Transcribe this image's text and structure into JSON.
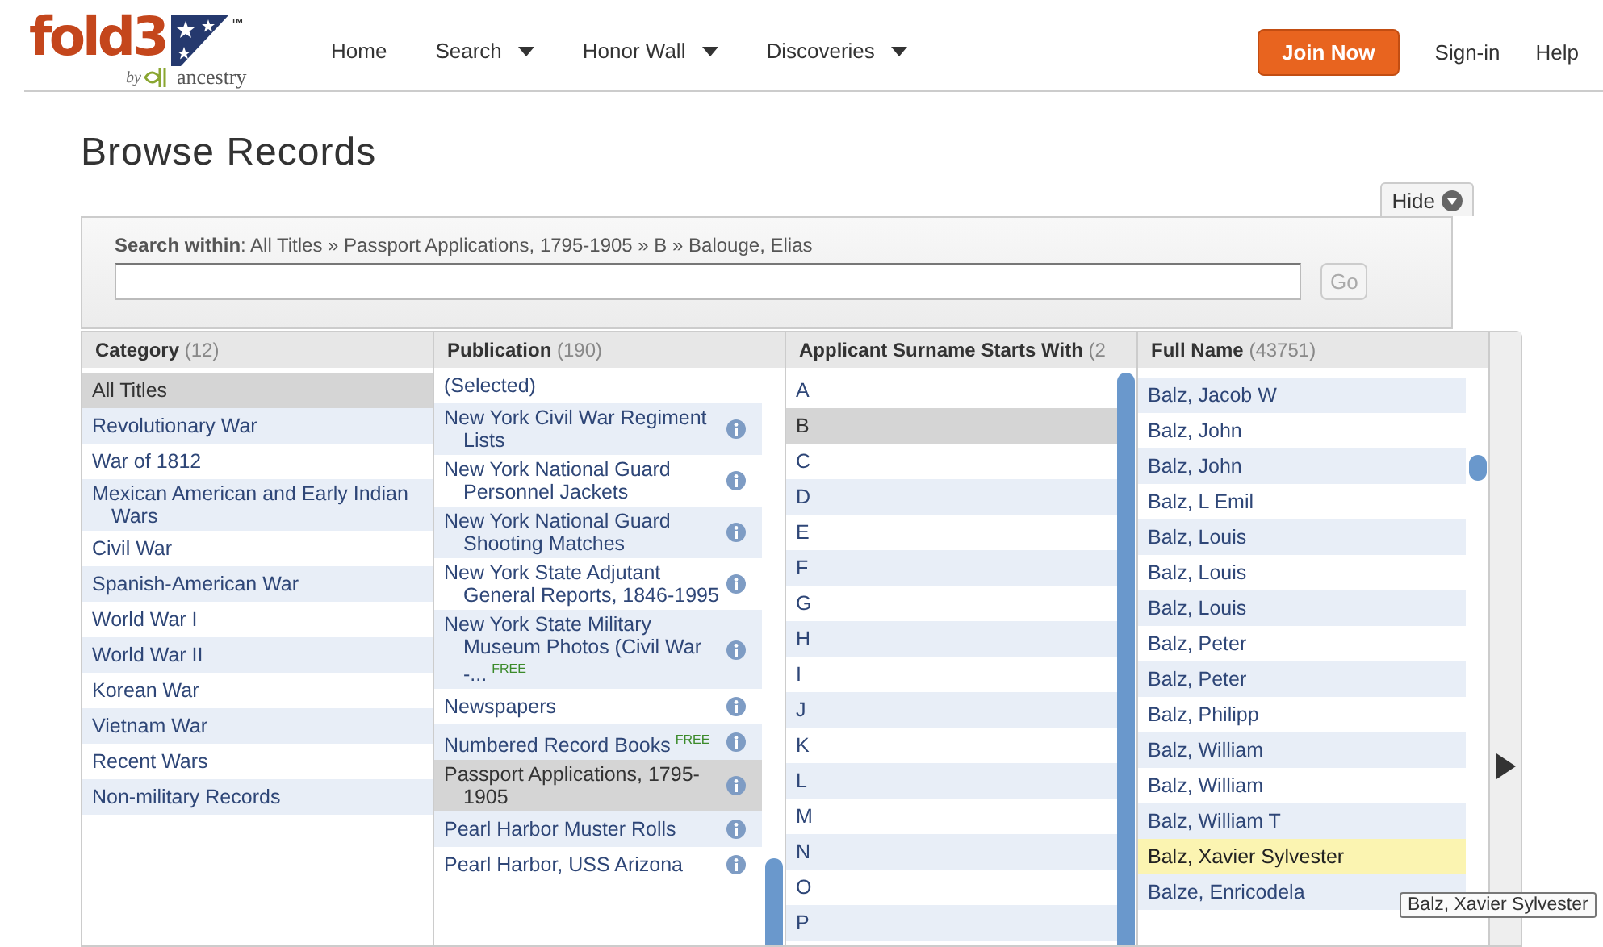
{
  "header": {
    "logo": {
      "name": "fold3",
      "trademark": "™",
      "by": "by",
      "partner": "ancestry"
    },
    "nav": [
      {
        "label": "Home",
        "dropdown": false
      },
      {
        "label": "Search",
        "dropdown": true
      },
      {
        "label": "Honor Wall",
        "dropdown": true
      },
      {
        "label": "Discoveries",
        "dropdown": true
      }
    ],
    "join_button": "Join Now",
    "links": [
      "Sign-in",
      "Help"
    ]
  },
  "title": "Browse Records",
  "hide_button": {
    "label": "Hide"
  },
  "search": {
    "label": "**Search within**: All Titles » Passport Applications, 1795-1905 » B » Balouge, Elias",
    "go_button": {
      "label": "Go",
      "disabled": true
    }
  },
  "columns": [
    {
      "title": "Category",
      "count": "(12)",
      "items": [
        {
          "label": "All Titles",
          "selected": true
        },
        {
          "label": "Revolutionary War",
          "selected": false
        },
        {
          "label": "War of 1812",
          "selected": false
        },
        {
          "label": "Mexican American and Early Indian Wars",
          "selected": false
        },
        {
          "label": "Civil War",
          "selected": false
        },
        {
          "label": "Spanish-American War",
          "selected": false
        },
        {
          "label": "World War I",
          "selected": false
        },
        {
          "label": "World War II",
          "selected": false
        },
        {
          "label": "Korean War",
          "selected": false
        },
        {
          "label": "Vietnam War",
          "selected": false
        },
        {
          "label": "Recent Wars",
          "selected": false
        },
        {
          "label": "Non-military Records",
          "selected": false
        }
      ]
    },
    {
      "title": "Publication",
      "count": "(190)",
      "items": [
        {
          "label": "(Selected)",
          "selected": false,
          "info": false
        },
        {
          "label": "New York Civil War Regiment Lists",
          "selected": false,
          "info": true
        },
        {
          "label": "New York National Guard Personnel Jackets",
          "selected": false,
          "info": true
        },
        {
          "label": "New York National Guard Shooting Matches",
          "selected": false,
          "info": true
        },
        {
          "label": "New York State Adjutant General Reports, 1846-1995",
          "selected": false,
          "info": true
        },
        {
          "label": "New York State Military Museum Photos (Civil War -...",
          "selected": false,
          "info": true,
          "badge": "FREE"
        },
        {
          "label": "Newspapers",
          "selected": false,
          "info": true
        },
        {
          "label": "Numbered Record Books",
          "selected": false,
          "info": true,
          "badge": "FREE"
        },
        {
          "label": "Passport Applications, 1795-1905",
          "selected": true,
          "info": true
        },
        {
          "label": "Pearl Harbor Muster Rolls",
          "selected": false,
          "info": true
        },
        {
          "label": "Pearl Harbor, USS Arizona",
          "selected": false,
          "info": true
        }
      ]
    },
    {
      "title": "Applicant Surname Starts With",
      "count": "(2",
      "items": [
        {
          "label": "A",
          "selected": false
        },
        {
          "label": "B",
          "selected": true
        },
        {
          "label": "C",
          "selected": false
        },
        {
          "label": "D",
          "selected": false
        },
        {
          "label": "E",
          "selected": false
        },
        {
          "label": "F",
          "selected": false
        },
        {
          "label": "G",
          "selected": false
        },
        {
          "label": "H",
          "selected": false
        },
        {
          "label": "I",
          "selected": false
        },
        {
          "label": "J",
          "selected": false
        },
        {
          "label": "K",
          "selected": false
        },
        {
          "label": "L",
          "selected": false
        },
        {
          "label": "M",
          "selected": false
        },
        {
          "label": "N",
          "selected": false
        },
        {
          "label": "O",
          "selected": false
        },
        {
          "label": "P",
          "selected": false
        }
      ]
    },
    {
      "title": "Full Name",
      "count": "(43751)",
      "items": [
        {
          "label": "Balz, Jacob W",
          "selected": false,
          "hovered": false
        },
        {
          "label": "Balz, John",
          "selected": false,
          "hovered": false
        },
        {
          "label": "Balz, John",
          "selected": false,
          "hovered": false
        },
        {
          "label": "Balz, L Emil",
          "selected": false,
          "hovered": false
        },
        {
          "label": "Balz, Louis",
          "selected": false,
          "hovered": false
        },
        {
          "label": "Balz, Louis",
          "selected": false,
          "hovered": false
        },
        {
          "label": "Balz, Louis",
          "selected": false,
          "hovered": false
        },
        {
          "label": "Balz, Peter",
          "selected": false,
          "hovered": false
        },
        {
          "label": "Balz, Peter",
          "selected": false,
          "hovered": false
        },
        {
          "label": "Balz, Philipp",
          "selected": false,
          "hovered": false
        },
        {
          "label": "Balz, William",
          "selected": false,
          "hovered": false
        },
        {
          "label": "Balz, William",
          "selected": false,
          "hovered": false
        },
        {
          "label": "Balz, William T",
          "selected": false,
          "hovered": false
        },
        {
          "label": "Balz, Xavier Sylvester",
          "selected": false,
          "hovered": true
        },
        {
          "label": "Balze, Enricodela",
          "selected": false,
          "hovered": false
        }
      ]
    }
  ],
  "tooltip": "Balz, Xavier Sylvester"
}
